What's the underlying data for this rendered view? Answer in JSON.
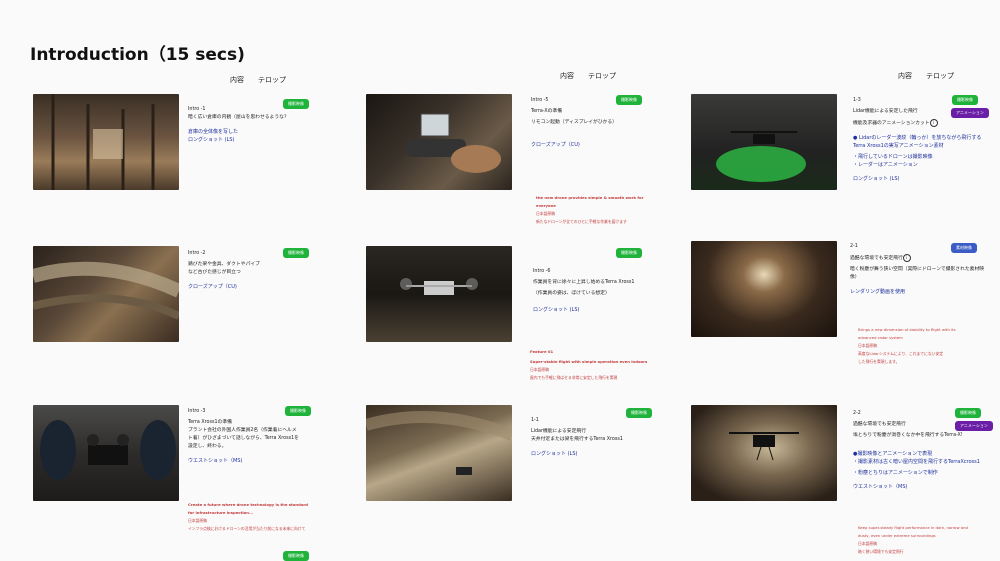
{
  "title": "Introduction（15 secs)",
  "colhead": {
    "a": "内容",
    "b": "テロップ"
  },
  "badges": {
    "film": "撮影映像",
    "anim": "アニメーション",
    "stock": "素材映像"
  },
  "c1": {
    "r1": {
      "id": "Intro -1",
      "lines": [
        "暗く広い倉庫の内観（屋山を思わせるような？"
      ],
      "b1": "倉庫の全体像を写した",
      "b2": "ロングショット (LS)"
    },
    "r2": {
      "id": "Intro -2",
      "lines": [
        "錆びた梁や金具、ダクトやパイプ",
        "など古びた感じが目立つ"
      ],
      "b1": "クローズアップ（CU)"
    },
    "r3": {
      "id": "Intro -3",
      "lines": [
        "Terra Xross1の準備",
        "プラント会社の外国人作業員2名（作業着にヘルメ",
        "ト着）がひざまづいて話しながら、Terra Xross1を",
        "設定し、終わる。"
      ],
      "b1": "ウエストショット（MS)",
      "red1": "Create a future where drone technology is the standard",
      "red2": "for infrastructure inspection...",
      "red3": "日本語原稿",
      "red4": "インフラ点検におけるドローンの活用が当たり前になる未来に向けて"
    }
  },
  "c2": {
    "r1": {
      "id": "Intro -5",
      "lines": [
        "Terra-Xの準備",
        "リモコン起動（ディスプレイがひかる）"
      ],
      "b1": "クローズアップ（CU)",
      "red1": "the new drone provides simple & smooth work for",
      "red2": "everyone",
      "red3": "日本語原稿",
      "red4": "新たなドローンが全てのひとに手軽な作業を届けます"
    },
    "r2": {
      "id": "Intro -6",
      "lines": [
        "作業員を背に徐々に上昇し始めるTerra Xross1",
        "（作業員の姿は、ぼけている想定)"
      ],
      "b1": "ロングショット (LS)",
      "red1": "Feature 01",
      "red2": "Super-stable flight with simple operation even indoors",
      "red3": "日本語原稿",
      "red4": "屋内でも手軽に飛ばせる非常に安定した飛行を実現"
    },
    "r3": {
      "id": "1-1",
      "lines": [
        "Lidar機能による安定飛行",
        "天井付近または梁を飛行するTerra Xross1"
      ],
      "b1": "ロングショット (LS)"
    }
  },
  "c3": {
    "r1": {
      "id": "1-3",
      "lines": [
        "Lidar機能による安定した飛行",
        "機能及求器のアニメーションカット"
      ],
      "circ": "i",
      "b1": "● Lidarのレーダー波紋（輪っか）を放ちながら飛行する",
      "b2": "Terra Xross1の実写アニメーション素材",
      "b3": "・飛行しているドローンは撮影映像",
      "b4": "・レーダーはアニメーション",
      "b5": "ロングショット (LS)"
    },
    "r2": {
      "id": "2-1",
      "lines": [
        "過酷な環境でも安定飛行"
      ],
      "circ": "i",
      "l2": "暗く粉塵が舞う狭い空間（実際にドローンで撮影された素材映像）",
      "b1": "レンダリング動画を使用",
      "red1": "Brings a new dimension of stability to flight with its",
      "red2": "advanced radar system",
      "red3": "日本語原稿",
      "red4": "高度なLidarシステムにより、これまでにない安定",
      "red5": "した飛行を実現します。"
    },
    "r3": {
      "id": "2-2",
      "lines": [
        "過酷な環境でも安定飛行",
        "埃とちりで粉塵が渦巻くなか中を飛行するTerra-X!"
      ],
      "b1": "●撮影映像とアニメーションで表現",
      "b2": "・撮影素材は古く暗い屋内空間を飛行するTerraXcross1",
      "b3": "・粉塵とちりはアニメーションで制作",
      "b4": "ウエストショット（MS)",
      "red1": "Keep super-steady flight performance in dark, narrow and",
      "red2": "dusty, even under extreme surroundings",
      "red3": "日本語原稿",
      "red4": "暗く狭い環境でも安定飛行"
    }
  }
}
